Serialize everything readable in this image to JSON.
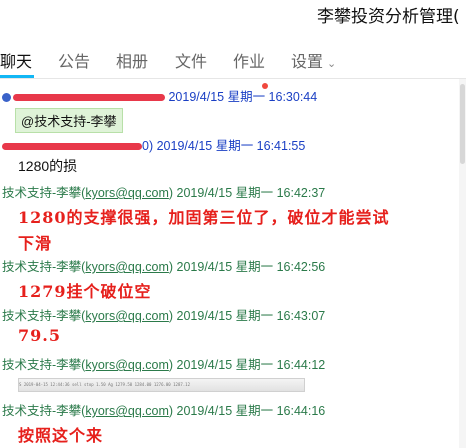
{
  "window": {
    "title": "李攀投资分析管理("
  },
  "tabs": [
    {
      "label": "聊天"
    },
    {
      "label": "公告"
    },
    {
      "label": "相册"
    },
    {
      "label": "文件"
    },
    {
      "label": "作业"
    },
    {
      "label": "设置"
    }
  ],
  "colors": {
    "accent": "#12b7f5",
    "red_text": "#e6201c",
    "sender_green": "#2b7a4a",
    "sender_blue": "#1a3fc4"
  },
  "messages": [
    {
      "sender": "",
      "timestamp": "2019/4/15 星期一 16:30:44",
      "mention": "@技术支持-李攀"
    },
    {
      "sender": "",
      "email_tail": "0)",
      "timestamp": "2019/4/15 星期一 16:41:55",
      "text": "1280的损"
    },
    {
      "sender": "技术支持-李攀",
      "email": "kyors@qq.com",
      "timestamp": "2019/4/15 星期一 16:42:37",
      "text_line1": "1280的支撑很强，加固第三位了，破位才能尝试",
      "text_line2": "下滑"
    },
    {
      "sender": "技术支持-李攀",
      "email": "kyors@qq.com",
      "timestamp": "2019/4/15 星期一 16:42:56",
      "text": "1279挂个破位空"
    },
    {
      "sender": "技术支持-李攀",
      "email": "kyors@qq.com",
      "timestamp": "2019/4/15 星期一 16:43:07",
      "text": "79.5"
    },
    {
      "sender": "技术支持-李攀",
      "email": "kyors@qq.com",
      "timestamp": "2019/4/15 星期一 16:44:12",
      "screenshot_text": "S    2019-04-15 12:44:36    sell stop    1.50    Ag    1279.50    1284.00    1276.00    1287.12"
    },
    {
      "sender": "技术支持-李攀",
      "email": "kyors@qq.com",
      "timestamp": "2019/4/15 星期一 16:44:16",
      "text": "按照这个来"
    }
  ]
}
